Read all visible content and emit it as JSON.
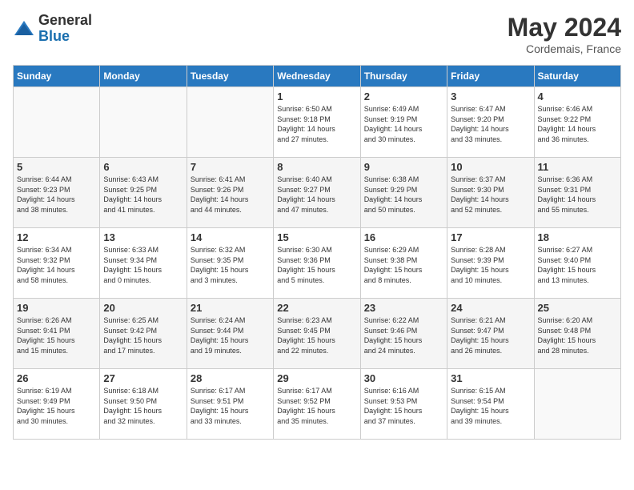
{
  "header": {
    "logo_general": "General",
    "logo_blue": "Blue",
    "month_title": "May 2024",
    "location": "Cordemais, France"
  },
  "days_of_week": [
    "Sunday",
    "Monday",
    "Tuesday",
    "Wednesday",
    "Thursday",
    "Friday",
    "Saturday"
  ],
  "weeks": [
    [
      {
        "day": "",
        "info": ""
      },
      {
        "day": "",
        "info": ""
      },
      {
        "day": "",
        "info": ""
      },
      {
        "day": "1",
        "info": "Sunrise: 6:50 AM\nSunset: 9:18 PM\nDaylight: 14 hours\nand 27 minutes."
      },
      {
        "day": "2",
        "info": "Sunrise: 6:49 AM\nSunset: 9:19 PM\nDaylight: 14 hours\nand 30 minutes."
      },
      {
        "day": "3",
        "info": "Sunrise: 6:47 AM\nSunset: 9:20 PM\nDaylight: 14 hours\nand 33 minutes."
      },
      {
        "day": "4",
        "info": "Sunrise: 6:46 AM\nSunset: 9:22 PM\nDaylight: 14 hours\nand 36 minutes."
      }
    ],
    [
      {
        "day": "5",
        "info": "Sunrise: 6:44 AM\nSunset: 9:23 PM\nDaylight: 14 hours\nand 38 minutes."
      },
      {
        "day": "6",
        "info": "Sunrise: 6:43 AM\nSunset: 9:25 PM\nDaylight: 14 hours\nand 41 minutes."
      },
      {
        "day": "7",
        "info": "Sunrise: 6:41 AM\nSunset: 9:26 PM\nDaylight: 14 hours\nand 44 minutes."
      },
      {
        "day": "8",
        "info": "Sunrise: 6:40 AM\nSunset: 9:27 PM\nDaylight: 14 hours\nand 47 minutes."
      },
      {
        "day": "9",
        "info": "Sunrise: 6:38 AM\nSunset: 9:29 PM\nDaylight: 14 hours\nand 50 minutes."
      },
      {
        "day": "10",
        "info": "Sunrise: 6:37 AM\nSunset: 9:30 PM\nDaylight: 14 hours\nand 52 minutes."
      },
      {
        "day": "11",
        "info": "Sunrise: 6:36 AM\nSunset: 9:31 PM\nDaylight: 14 hours\nand 55 minutes."
      }
    ],
    [
      {
        "day": "12",
        "info": "Sunrise: 6:34 AM\nSunset: 9:32 PM\nDaylight: 14 hours\nand 58 minutes."
      },
      {
        "day": "13",
        "info": "Sunrise: 6:33 AM\nSunset: 9:34 PM\nDaylight: 15 hours\nand 0 minutes."
      },
      {
        "day": "14",
        "info": "Sunrise: 6:32 AM\nSunset: 9:35 PM\nDaylight: 15 hours\nand 3 minutes."
      },
      {
        "day": "15",
        "info": "Sunrise: 6:30 AM\nSunset: 9:36 PM\nDaylight: 15 hours\nand 5 minutes."
      },
      {
        "day": "16",
        "info": "Sunrise: 6:29 AM\nSunset: 9:38 PM\nDaylight: 15 hours\nand 8 minutes."
      },
      {
        "day": "17",
        "info": "Sunrise: 6:28 AM\nSunset: 9:39 PM\nDaylight: 15 hours\nand 10 minutes."
      },
      {
        "day": "18",
        "info": "Sunrise: 6:27 AM\nSunset: 9:40 PM\nDaylight: 15 hours\nand 13 minutes."
      }
    ],
    [
      {
        "day": "19",
        "info": "Sunrise: 6:26 AM\nSunset: 9:41 PM\nDaylight: 15 hours\nand 15 minutes."
      },
      {
        "day": "20",
        "info": "Sunrise: 6:25 AM\nSunset: 9:42 PM\nDaylight: 15 hours\nand 17 minutes."
      },
      {
        "day": "21",
        "info": "Sunrise: 6:24 AM\nSunset: 9:44 PM\nDaylight: 15 hours\nand 19 minutes."
      },
      {
        "day": "22",
        "info": "Sunrise: 6:23 AM\nSunset: 9:45 PM\nDaylight: 15 hours\nand 22 minutes."
      },
      {
        "day": "23",
        "info": "Sunrise: 6:22 AM\nSunset: 9:46 PM\nDaylight: 15 hours\nand 24 minutes."
      },
      {
        "day": "24",
        "info": "Sunrise: 6:21 AM\nSunset: 9:47 PM\nDaylight: 15 hours\nand 26 minutes."
      },
      {
        "day": "25",
        "info": "Sunrise: 6:20 AM\nSunset: 9:48 PM\nDaylight: 15 hours\nand 28 minutes."
      }
    ],
    [
      {
        "day": "26",
        "info": "Sunrise: 6:19 AM\nSunset: 9:49 PM\nDaylight: 15 hours\nand 30 minutes."
      },
      {
        "day": "27",
        "info": "Sunrise: 6:18 AM\nSunset: 9:50 PM\nDaylight: 15 hours\nand 32 minutes."
      },
      {
        "day": "28",
        "info": "Sunrise: 6:17 AM\nSunset: 9:51 PM\nDaylight: 15 hours\nand 33 minutes."
      },
      {
        "day": "29",
        "info": "Sunrise: 6:17 AM\nSunset: 9:52 PM\nDaylight: 15 hours\nand 35 minutes."
      },
      {
        "day": "30",
        "info": "Sunrise: 6:16 AM\nSunset: 9:53 PM\nDaylight: 15 hours\nand 37 minutes."
      },
      {
        "day": "31",
        "info": "Sunrise: 6:15 AM\nSunset: 9:54 PM\nDaylight: 15 hours\nand 39 minutes."
      },
      {
        "day": "",
        "info": ""
      }
    ]
  ]
}
